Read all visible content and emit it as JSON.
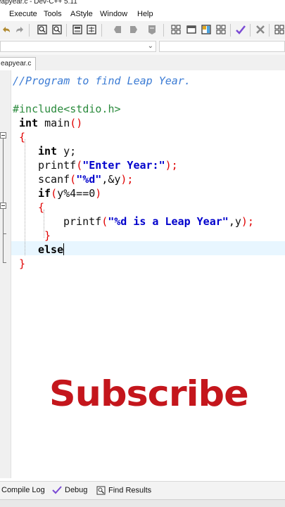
{
  "window": {
    "title": "eapyear.c - Dev-C++ 5.11"
  },
  "menu": {
    "items": [
      "Execute",
      "Tools",
      "AStyle",
      "Window",
      "Help"
    ]
  },
  "tabs": [
    {
      "label": "eapyear.c"
    }
  ],
  "code": {
    "comment": "//Program to find Leap Year.",
    "include": "#include<stdio.h>",
    "int_kw": "int",
    "main": " main",
    "paren_pair": "()",
    "brace_open": "{",
    "brace_close": "}",
    "int_y_kw": "int",
    "int_y_rest": " y;",
    "printf1_fn": "printf",
    "printf1_open": "(",
    "printf1_str": "\"Enter Year:\"",
    "printf1_close": ");",
    "scanf_fn": "scanf",
    "scanf_open": "(",
    "scanf_str": "\"%d\"",
    "scanf_rest": ",&y",
    "scanf_close": ");",
    "if_kw": "if",
    "if_open": "(",
    "if_cond": "y%4==0",
    "if_close": ")",
    "printf2_fn": "printf",
    "printf2_open": "(",
    "printf2_str": "\"%d is a Leap Year\"",
    "printf2_rest": ",y",
    "printf2_close": ");",
    "else_kw": "else"
  },
  "overlay": {
    "text": "Subscribe",
    "color": "#c4161c"
  },
  "bottom_tabs": [
    {
      "label": "Compile Log",
      "icon": "compile-log-icon"
    },
    {
      "label": "Debug",
      "icon": "debug-check-icon"
    },
    {
      "label": "Find Results",
      "icon": "find-results-icon"
    }
  ],
  "colors": {
    "comment": "#3b7bd4",
    "preprocessor": "#2a8a3c",
    "string": "#0000cc",
    "brace": "#e00000",
    "current_line": "#e8f6ff"
  }
}
